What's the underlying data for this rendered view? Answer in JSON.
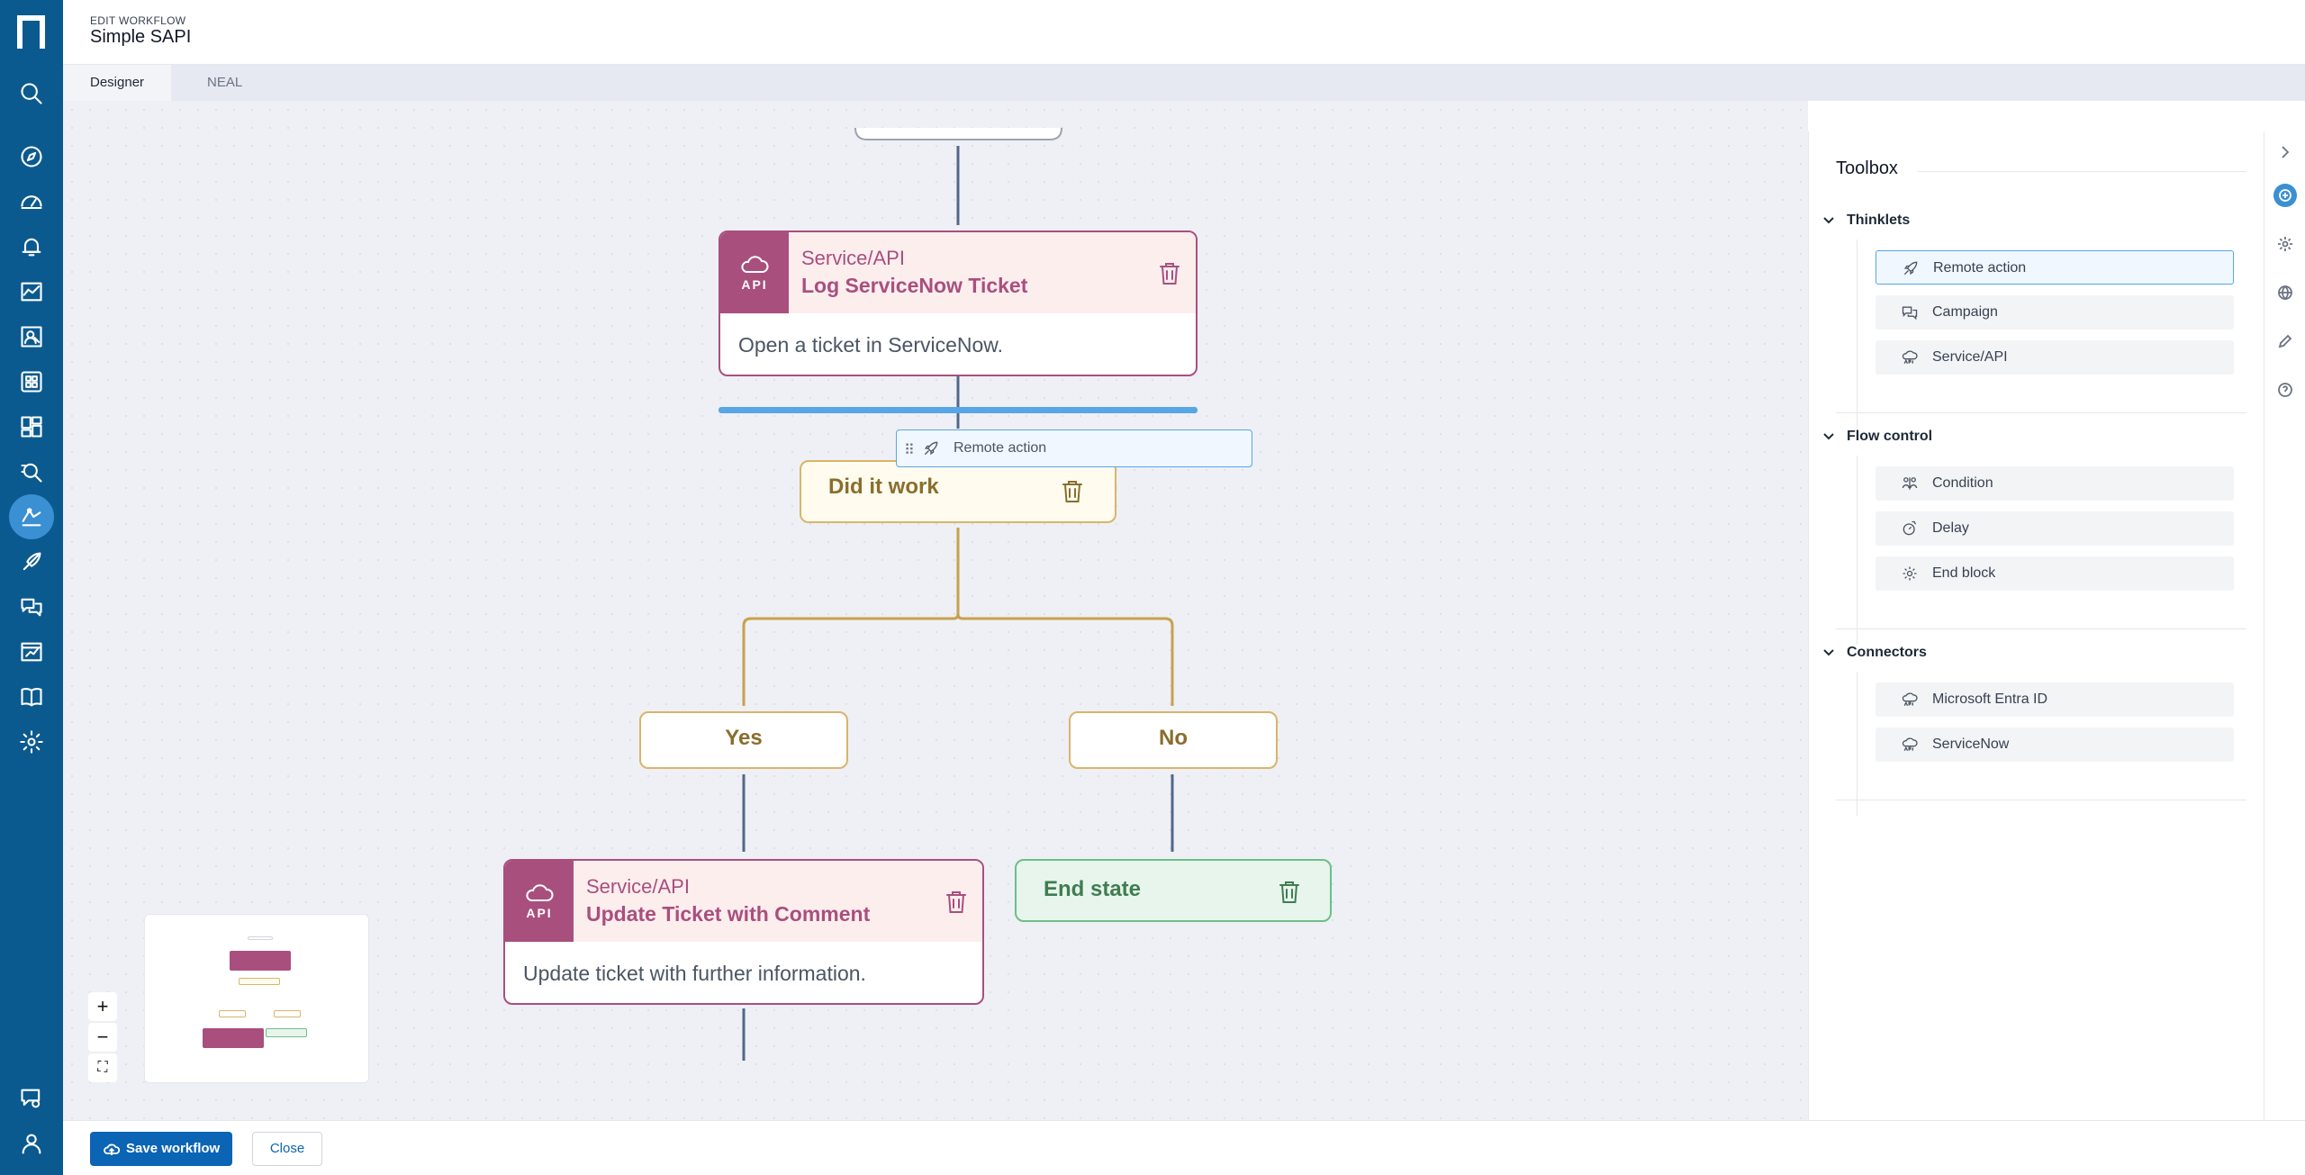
{
  "header": {
    "eyebrow": "EDIT WORKFLOW",
    "title": "Simple SAPI"
  },
  "tabs": [
    {
      "label": "Designer",
      "active": true
    },
    {
      "label": "NEAL",
      "active": false
    }
  ],
  "nodes": {
    "log_ticket": {
      "type": "Service/API",
      "name": "Log ServiceNow Ticket",
      "description": "Open a ticket in ServiceNow.",
      "api_label": "API"
    },
    "condition": {
      "label": "Did it work"
    },
    "yes": {
      "label": "Yes"
    },
    "no": {
      "label": "No"
    },
    "update_ticket": {
      "type": "Service/API",
      "name": "Update Ticket with Comment",
      "description": "Update ticket with further information.",
      "api_label": "API"
    },
    "end_state": {
      "label": "End state"
    }
  },
  "drag_chip": {
    "label": "Remote action",
    "grip": "⠿"
  },
  "zoom": {
    "in": "+",
    "out": "−",
    "fit": "⛶"
  },
  "toolbox": {
    "title": "Toolbox",
    "sections": [
      {
        "title": "Thinklets",
        "items": [
          {
            "label": "Remote action",
            "icon": "rocket-icon",
            "selected": true
          },
          {
            "label": "Campaign",
            "icon": "chat-icon"
          },
          {
            "label": "Service/API",
            "icon": "cloud-api-icon"
          }
        ]
      },
      {
        "title": "Flow control",
        "items": [
          {
            "label": "Condition",
            "icon": "condition-icon"
          },
          {
            "label": "Delay",
            "icon": "timer-icon"
          },
          {
            "label": "End block",
            "icon": "gear-icon"
          }
        ]
      },
      {
        "title": "Connectors",
        "items": [
          {
            "label": "Microsoft Entra ID",
            "icon": "cloud-api-icon"
          },
          {
            "label": "ServiceNow",
            "icon": "cloud-api-icon"
          }
        ]
      }
    ]
  },
  "footer": {
    "save_label": "Save workflow",
    "close_label": "Close"
  },
  "colors": {
    "nav": "#0b5a8f",
    "service": "#a94f7e",
    "condition": "#d8b56a",
    "end": "#6dbf86",
    "accent": "#57a6e6"
  }
}
